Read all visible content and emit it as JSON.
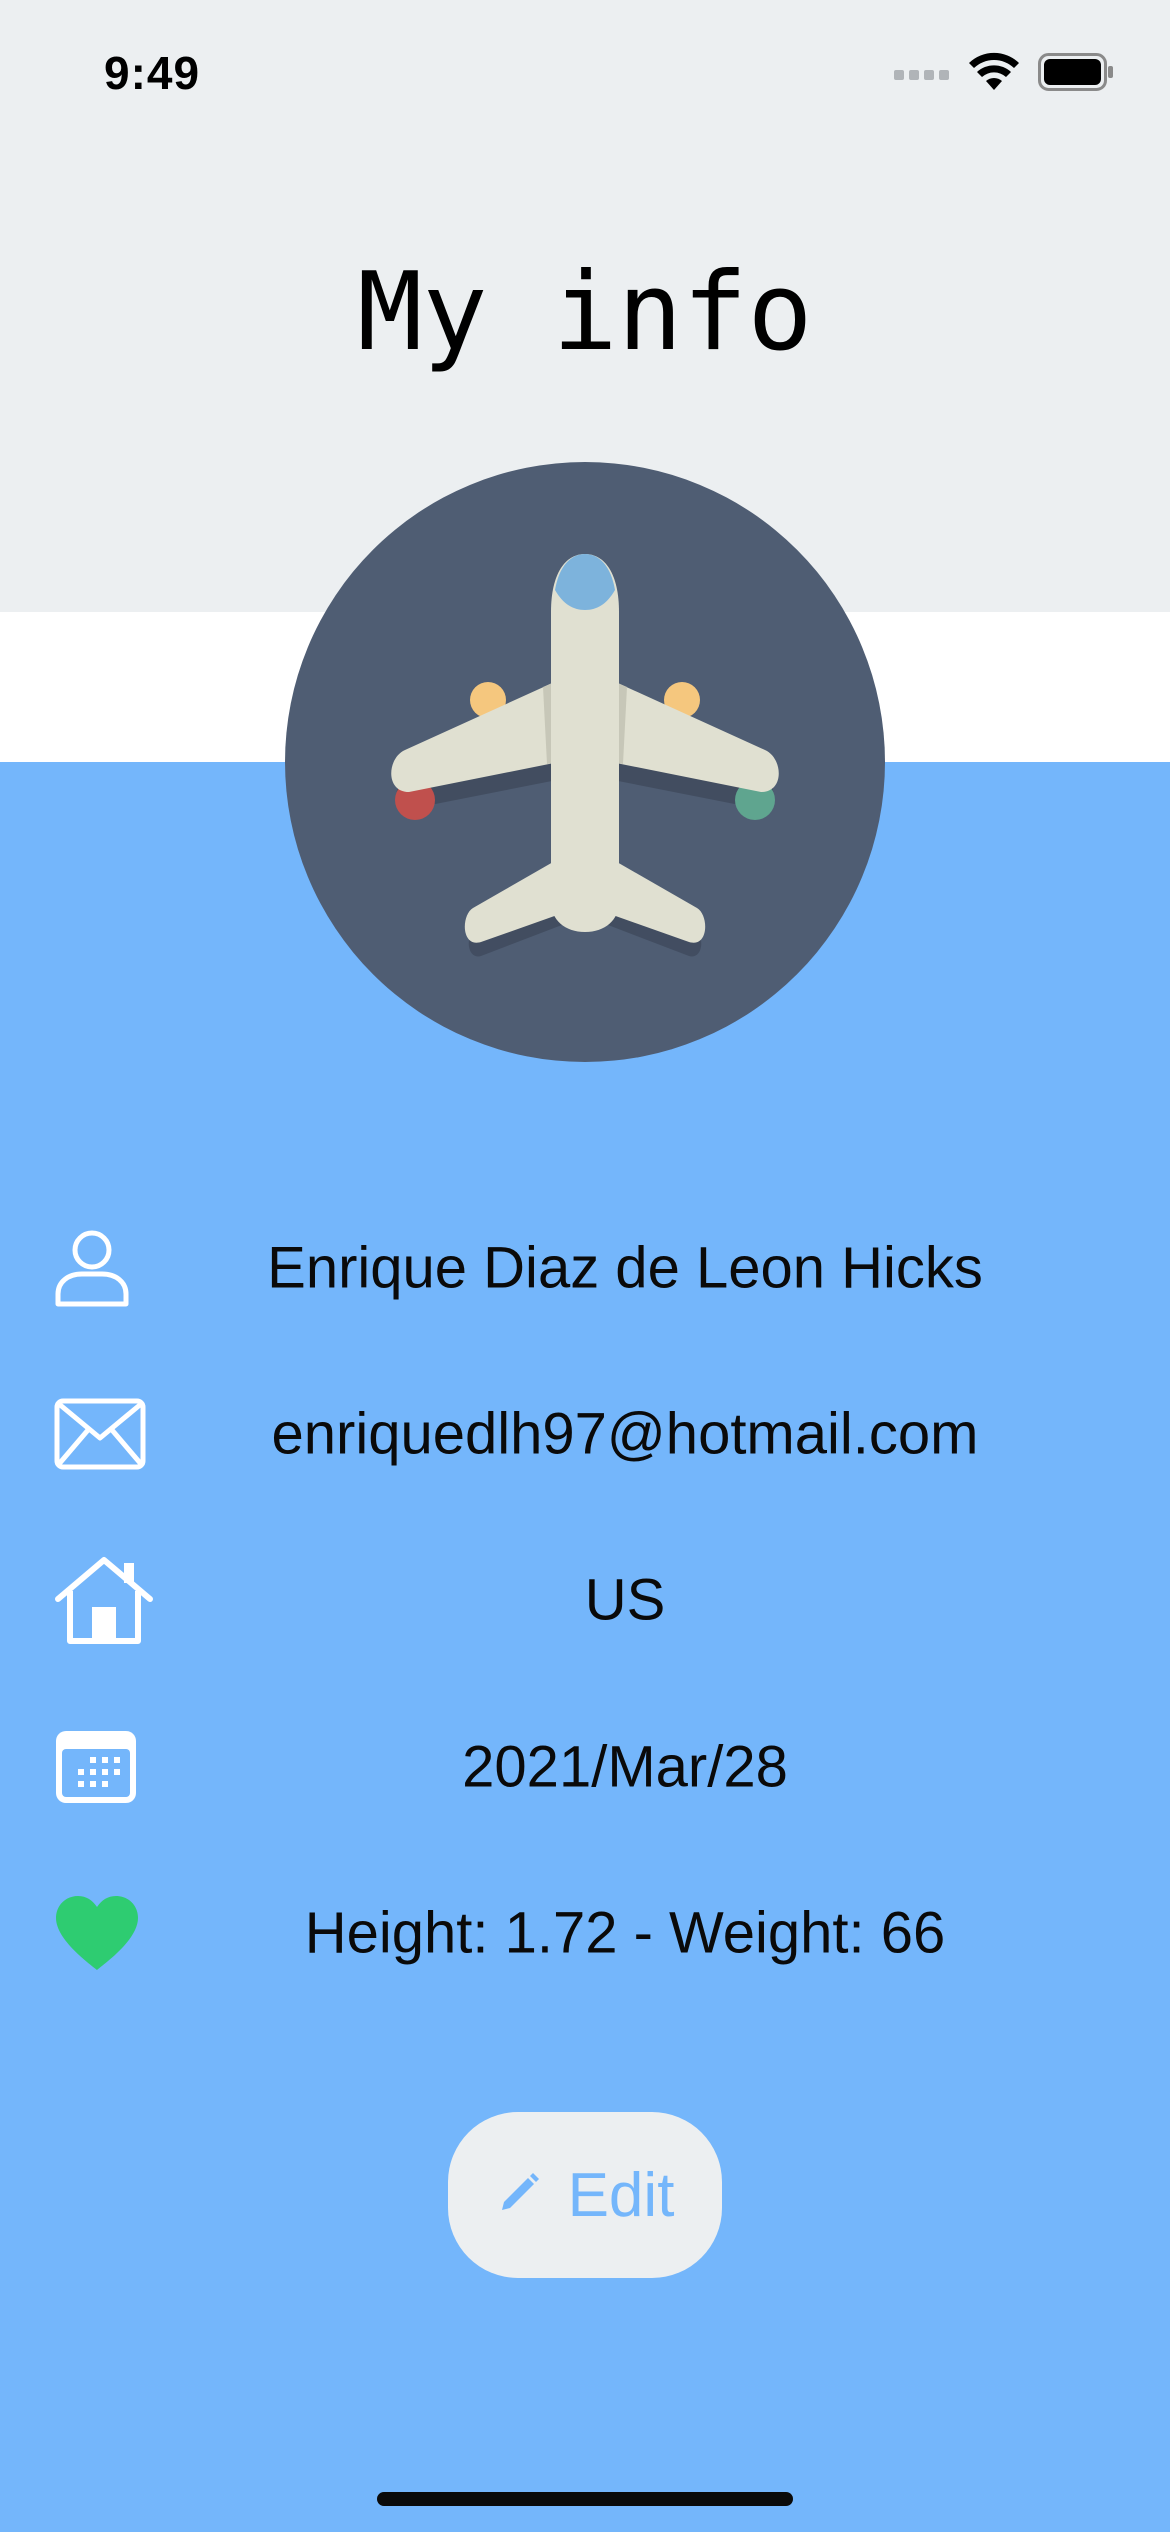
{
  "status_bar": {
    "time": "9:49",
    "icons": [
      "cellular-signal-icon",
      "wifi-icon",
      "battery-icon"
    ]
  },
  "header": {
    "title": "My info"
  },
  "avatar": {
    "icon": "airplane-icon"
  },
  "info": {
    "name": "Enrique Diaz de Leon Hicks",
    "email": "enriquedlh97@hotmail.com",
    "country": "US",
    "date": "2021/Mar/28",
    "health": "Height: 1.72 - Weight: 66"
  },
  "icons": {
    "name": "person-icon",
    "email": "envelope-icon",
    "country": "house-icon",
    "date": "calendar-icon",
    "health": "heart-icon"
  },
  "actions": {
    "edit_label": "Edit",
    "edit_icon": "pencil-icon"
  },
  "colors": {
    "background_top": "#eceff1",
    "band": "#ffffff",
    "background_main": "#74b6fb",
    "avatar_bg": "#4f5d73",
    "heart": "#2ecc71",
    "accent": "#74b6fb"
  }
}
